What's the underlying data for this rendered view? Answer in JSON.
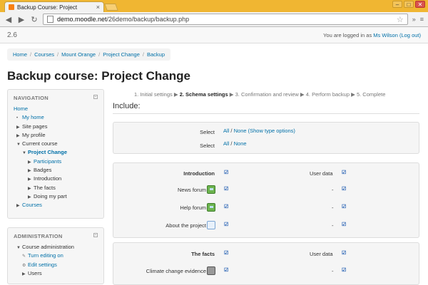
{
  "browser": {
    "tab_title": "Backup Course: Project",
    "tab_close": "×",
    "url_host": "demo.moodle.net",
    "url_path": "/26demo/backup/backup.php",
    "win_min": "–",
    "win_max": "□",
    "win_close": "✕"
  },
  "header": {
    "version": "2.6",
    "login_prefix": "You are logged in as ",
    "user": "Ms Wilson",
    "logout": "(Log out)"
  },
  "breadcrumb": [
    "Home",
    "Courses",
    "Mount Orange",
    "Project Change",
    "Backup"
  ],
  "page_title": "Backup course: Project Change",
  "steps": {
    "s1": "1. Initial settings ▶ ",
    "s2": "2. Schema settings",
    "s3": " ▶ 3. Confirmation and review ▶ 4. Perform backup ▶ 5. Complete"
  },
  "include_heading": "Include:",
  "navigation": {
    "title": "NAVIGATION",
    "home": "Home",
    "my_home": "My home",
    "site_pages": "Site pages",
    "my_profile": "My profile",
    "current_course": "Current course",
    "project_change": "Project Change",
    "participants": "Participants",
    "badges": "Badges",
    "introduction": "Introduction",
    "the_facts": "The facts",
    "doing_my_part": "Doing my part",
    "courses": "Courses"
  },
  "administration": {
    "title": "ADMINISTRATION",
    "course_admin": "Course administration",
    "turn_editing": "Turn editing on",
    "edit_settings": "Edit settings",
    "users": "Users"
  },
  "select": {
    "label": "Select",
    "all": "All",
    "slash": " / ",
    "none": "None",
    "show_type": "(Show type options)"
  },
  "section1": {
    "title": "Introduction",
    "user_data": "User data",
    "items": [
      "News forum",
      "Help forum",
      "About the project"
    ],
    "dash": "-"
  },
  "section2": {
    "title": "The facts",
    "user_data": "User data",
    "items": [
      "Climate change evidence"
    ],
    "dash": "-"
  },
  "checkmark": "☑",
  "colors": {
    "chrome": "#f0b632",
    "link": "#0070a8",
    "checkbox": "#2a64b5"
  }
}
